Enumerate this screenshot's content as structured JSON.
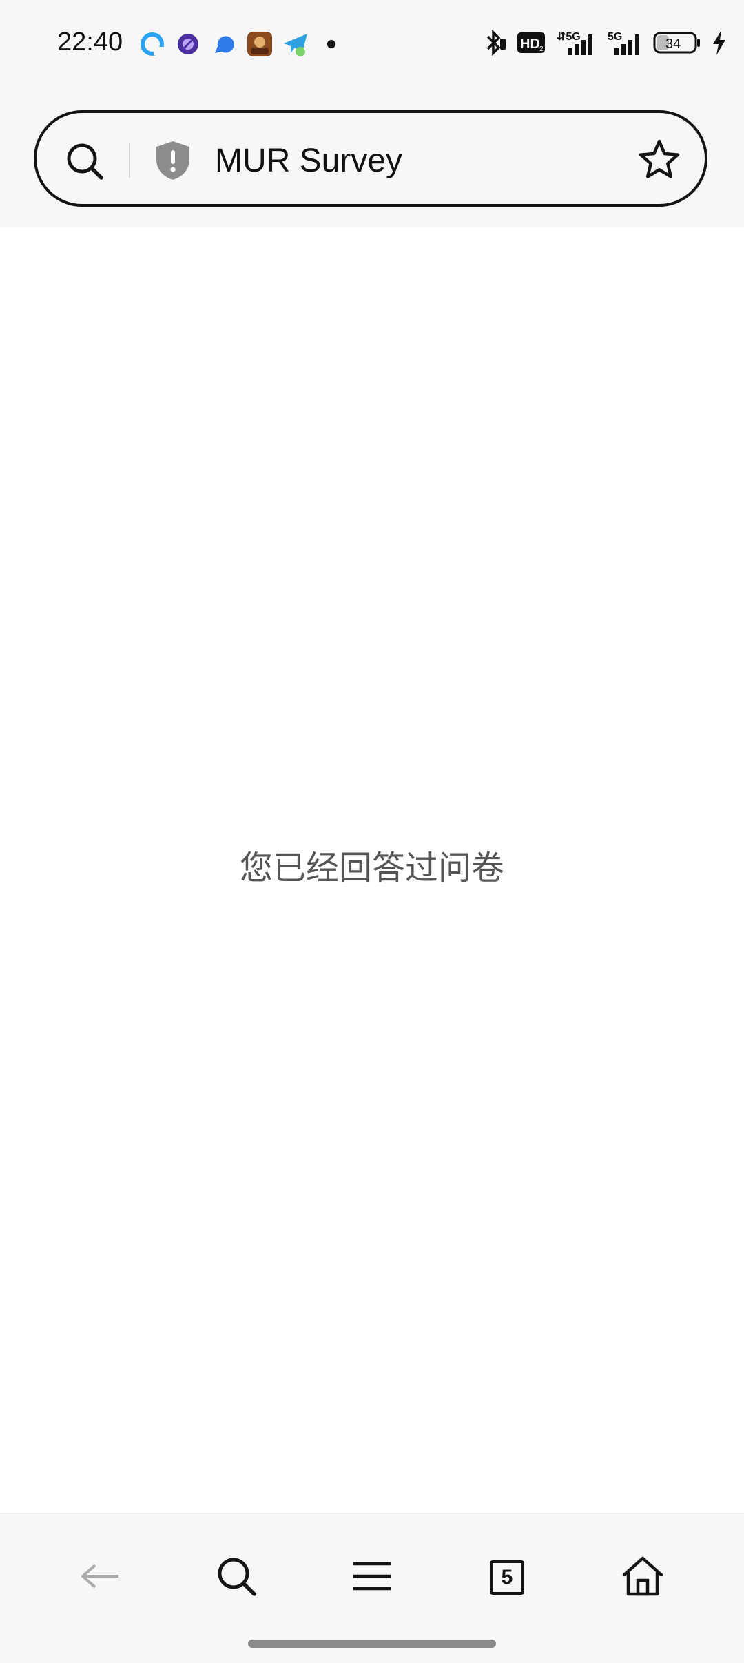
{
  "status_bar": {
    "time": "22:40",
    "notification_icons": [
      "app-q-icon",
      "purple-circle-app-icon",
      "blue-bubble-app-icon",
      "game-avatar-app-icon",
      "telegram-icon",
      "dot-icon"
    ],
    "battery_level": "34",
    "network_labels": [
      "HD",
      "5G",
      "5G"
    ]
  },
  "address_bar": {
    "title": "MUR Survey",
    "icons": [
      "search-icon",
      "security-shield-icon",
      "star-icon"
    ]
  },
  "content": {
    "message": "您已经回答过问卷"
  },
  "bottom_nav": {
    "tab_count": "5",
    "icons": [
      "back-arrow-icon",
      "search-icon",
      "menu-icon",
      "tabs-icon",
      "home-icon"
    ]
  },
  "colors": {
    "header_background": "#f7f7f7",
    "page_background": "#ffffff",
    "message_text": "#555555",
    "disabled_icon": "#aaaaaa"
  }
}
